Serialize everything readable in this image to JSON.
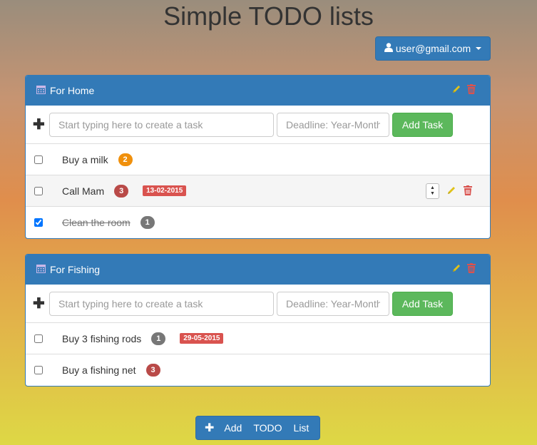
{
  "app": {
    "title": "Simple TODO lists"
  },
  "user": {
    "email": "user@gmail.com"
  },
  "lists": [
    {
      "name": "For Home",
      "new_task": {
        "placeholder": "Start typing here to create a task",
        "deadline_placeholder": "Deadline: Year-Month-Day",
        "button": "Add Task"
      },
      "tasks": [
        {
          "name": "Buy a milk",
          "priority": "2",
          "done": false,
          "deadline": ""
        },
        {
          "name": "Call Mam",
          "priority": "3",
          "done": false,
          "deadline": "13-02-2015"
        },
        {
          "name": "Clean the room",
          "priority": "1",
          "done": true,
          "deadline": ""
        }
      ]
    },
    {
      "name": "For Fishing",
      "new_task": {
        "placeholder": "Start typing here to create a task",
        "deadline_placeholder": "Deadline: Year-Month-Day",
        "button": "Add Task"
      },
      "tasks": [
        {
          "name": "Buy 3 fishing rods",
          "priority": "1",
          "done": false,
          "deadline": "29-05-2015"
        },
        {
          "name": "Buy a fishing net",
          "priority": "3",
          "done": false,
          "deadline": ""
        }
      ]
    }
  ],
  "footer": {
    "add_list_words": [
      "Add",
      "TODO",
      "List"
    ]
  },
  "colors": {
    "primary": "#337ab7",
    "success": "#5cb85c",
    "danger": "#d9534f",
    "edit": "#e0c219"
  },
  "icons": {
    "user": "user-icon",
    "calendar": "calendar-icon",
    "edit": "pencil-icon",
    "delete": "trash-icon",
    "add": "plus-icon"
  }
}
